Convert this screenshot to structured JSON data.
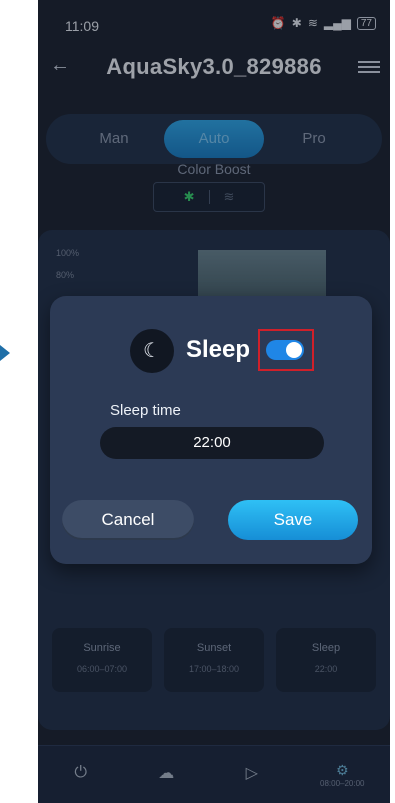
{
  "status_bar": {
    "time": "11:09",
    "battery": "77"
  },
  "header": {
    "title": "AquaSky3.0_829886"
  },
  "mode_tabs": [
    {
      "label": "Man"
    },
    {
      "label": "Auto"
    },
    {
      "label": "Pro"
    }
  ],
  "color_boost": {
    "label": "Color Boost"
  },
  "chart": {
    "label_100": "100%",
    "label_80": "80%"
  },
  "presets": [
    {
      "title": "Sunrise",
      "time": "06:00–07:00"
    },
    {
      "title": "Sunset",
      "time": "17:00–18:00"
    },
    {
      "title": "Sleep",
      "time": "22:00"
    }
  ],
  "bottom_bar": {
    "schedule": "08:00–20:00"
  },
  "modal": {
    "title": "Sleep",
    "toggle_state": "on",
    "sleep_time_label": "Sleep time",
    "sleep_time_value": "22:00",
    "cancel_label": "Cancel",
    "save_label": "Save"
  },
  "colors": {
    "accent": "#1f86e6",
    "save_gradient_start": "#2fc0f5",
    "cancel_bg": "#3d4c66",
    "highlight_outline": "#d0202a"
  }
}
